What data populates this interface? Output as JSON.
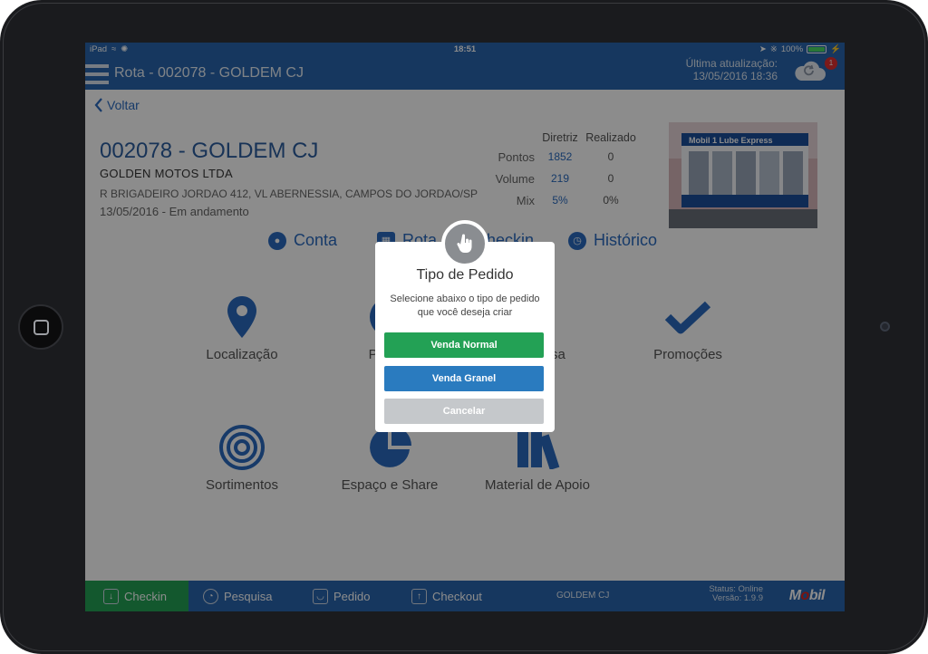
{
  "statusbar": {
    "device": "iPad",
    "time": "18:51",
    "battery": "100%"
  },
  "header": {
    "title": "Rota - 002078 - GOLDEM CJ",
    "update_label": "Última atualização:",
    "update_date": "13/05/2016 18:36",
    "sync_badge": "1"
  },
  "back": {
    "label": "Voltar"
  },
  "customer": {
    "code_name": "002078 - GOLDEM CJ",
    "company": "GOLDEN MOTOS LTDA",
    "address": "R BRIGADEIRO JORDAO 412, VL ABERNESSIA, CAMPOS DO JORDAO/SP",
    "date_status": "13/05/2016 - Em andamento"
  },
  "stats": {
    "headers": {
      "diretriz": "Diretriz",
      "realizado": "Realizado"
    },
    "rows": [
      {
        "label": "Pontos",
        "diretriz": "1852",
        "realizado": "0"
      },
      {
        "label": "Volume",
        "diretriz": "219",
        "realizado": "0"
      },
      {
        "label": "Mix",
        "diretriz": "5%",
        "realizado": "0%"
      }
    ]
  },
  "store_image": {
    "sign": "Mobil 1 Lube Express"
  },
  "tabs": {
    "conta": "Conta",
    "rota": "Rota",
    "checkin": "Checkin",
    "historico": "Histórico"
  },
  "tiles": {
    "localizacao": "Localização",
    "pedido": "Pedido",
    "pesquisa": "Pesquisa",
    "promocoes": "Promoções",
    "sortimentos": "Sortimentos",
    "espaco_share": "Espaço e Share",
    "material_apoio": "Material de Apoio"
  },
  "bottombar": {
    "checkin": "Checkin",
    "pesquisa": "Pesquisa",
    "pedido": "Pedido",
    "checkout": "Checkout",
    "client": "GOLDEM CJ",
    "status": "Status: Online",
    "version": "Versão: 1.9.9",
    "brand_pre": "M",
    "brand_o": "o",
    "brand_post": "bil"
  },
  "modal": {
    "title": "Tipo de Pedido",
    "text": "Selecione abaixo o tipo de pedido que você deseja criar",
    "btn_normal": "Venda Normal",
    "btn_granel": "Venda Granel",
    "btn_cancel": "Cancelar"
  },
  "colors": {
    "nav_blue": "#2865ad",
    "checkin_green": "#23a155",
    "granel_blue": "#2a7bbf",
    "cancel_gray": "#c5c8cb"
  }
}
